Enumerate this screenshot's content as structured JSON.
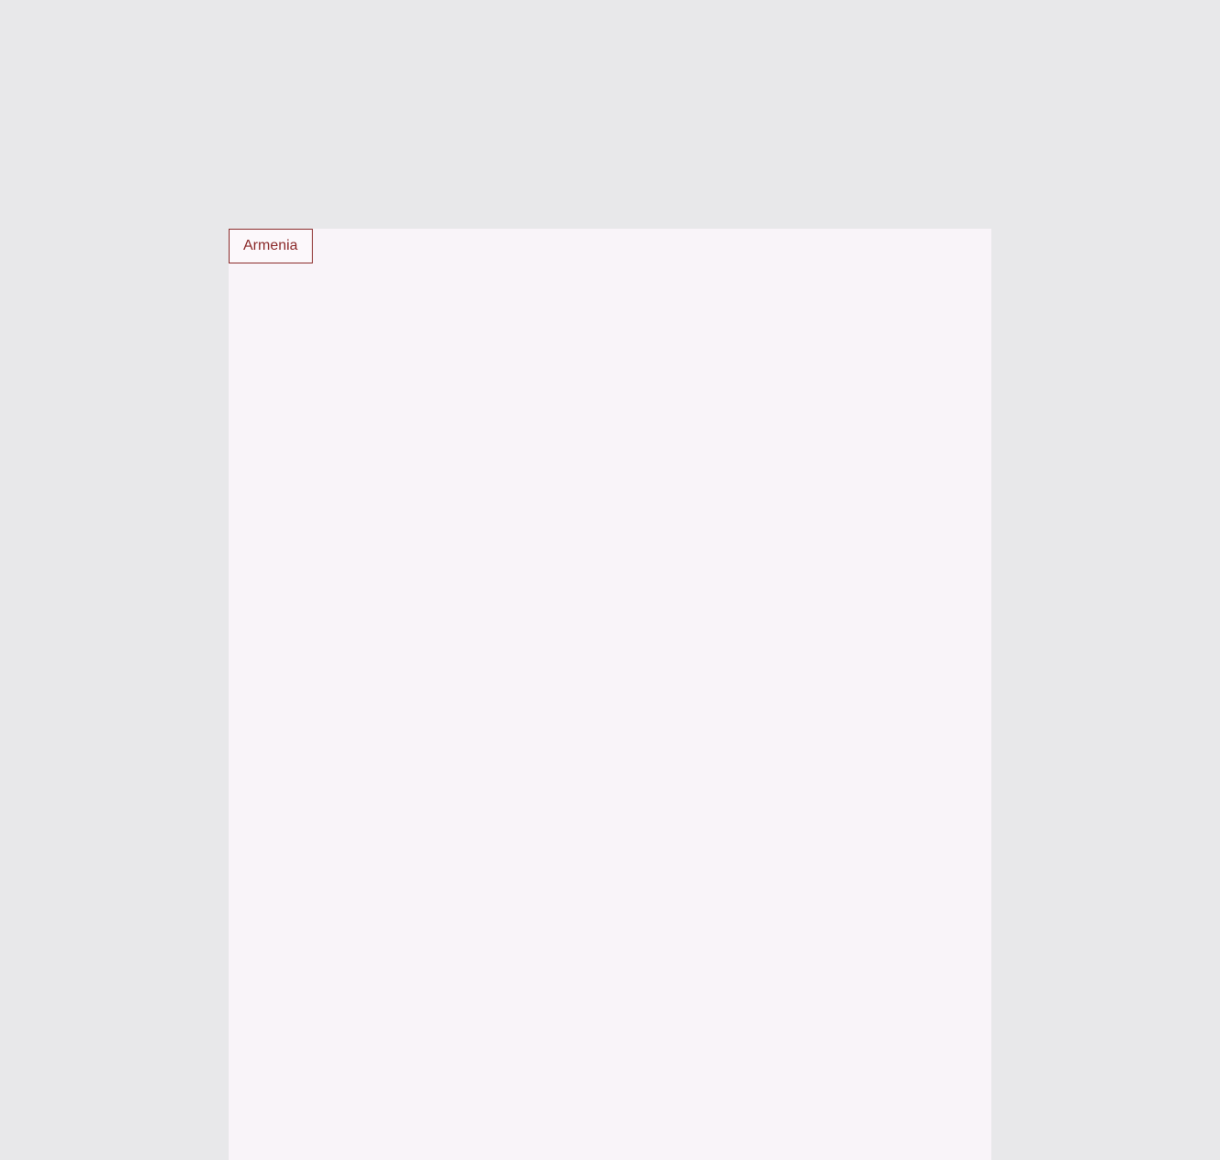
{
  "panel": {
    "tag_label": "Armenia"
  },
  "colors": {
    "page_background": "#e8e8ea",
    "panel_background": "#f9f4f9",
    "accent": "#8b2a2a"
  }
}
